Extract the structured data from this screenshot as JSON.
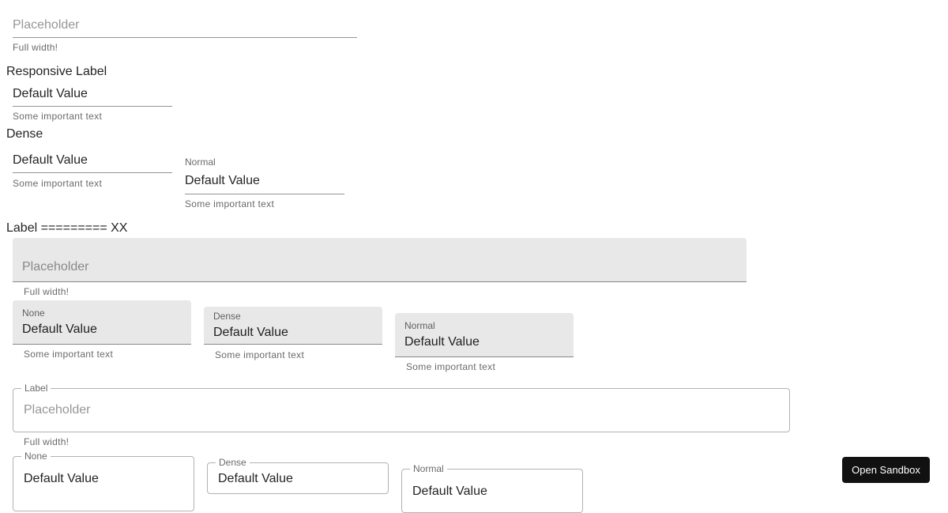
{
  "standard": {
    "full_width": {
      "placeholder": "Placeholder",
      "helper": "Full width!"
    },
    "responsive_label": "Responsive Label",
    "responsive_field": {
      "value": "Default Value",
      "helper": "Some important text"
    },
    "dense_label": "Dense",
    "dense_field": {
      "value": "Default Value",
      "helper": "Some important text"
    },
    "normal_field": {
      "label": "Normal",
      "value": "Default Value",
      "helper": "Some important text"
    }
  },
  "section_label": "Label ========= XX",
  "filled": {
    "full_width": {
      "placeholder": "Placeholder",
      "helper": "Full width!"
    },
    "none": {
      "label": "None",
      "value": "Default Value",
      "helper": "Some important text"
    },
    "dense": {
      "label": "Dense",
      "value": "Default Value",
      "helper": "Some important text"
    },
    "normal": {
      "label": "Normal",
      "value": "Default Value",
      "helper": "Some important text"
    }
  },
  "outlined": {
    "full_width": {
      "label": "Label",
      "placeholder": "Placeholder",
      "helper": "Full width!"
    },
    "none": {
      "label": "None",
      "value": "Default Value"
    },
    "dense": {
      "label": "Dense",
      "value": "Default Value"
    },
    "normal": {
      "label": "Normal",
      "value": "Default Value"
    }
  },
  "sandbox_button": "Open Sandbox"
}
